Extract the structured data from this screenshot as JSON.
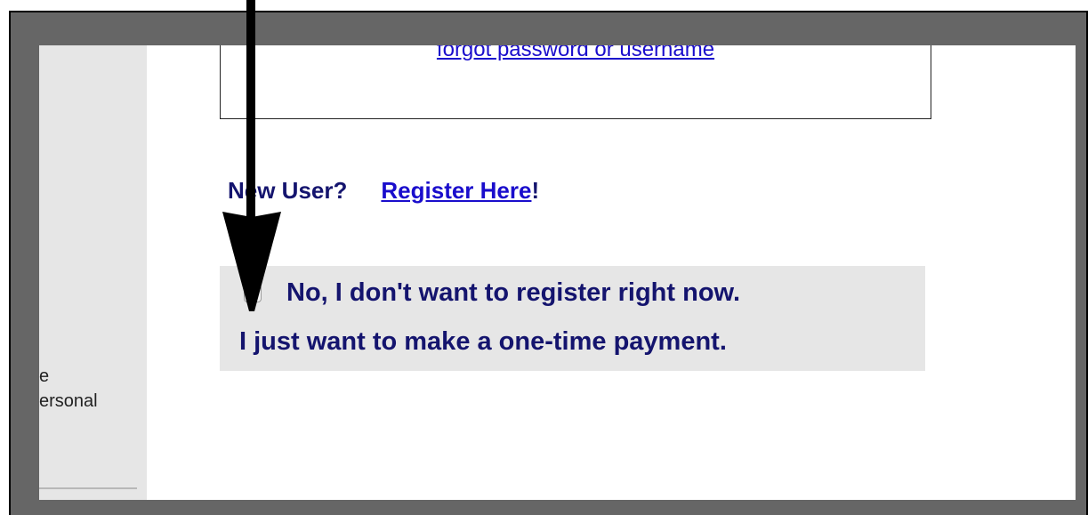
{
  "page": {
    "forgot_link": "forgot password or username",
    "new_user_label": "New User?",
    "register_link": "Register Here",
    "register_suffix": "!",
    "guest_line1": "No, I don't want to register right now.",
    "guest_line2": "I just want to make a one-time payment.",
    "guest_checkbox_checked": false,
    "left_column_text": "e\nersonal"
  },
  "colors": {
    "frame_grey": "#666666",
    "page_heading_navy": "#14146e",
    "link_blue": "#1a0dcc",
    "panel_grey": "#e6e6e6"
  },
  "annotation": {
    "arrow_icon": "down-arrow-pointer"
  }
}
